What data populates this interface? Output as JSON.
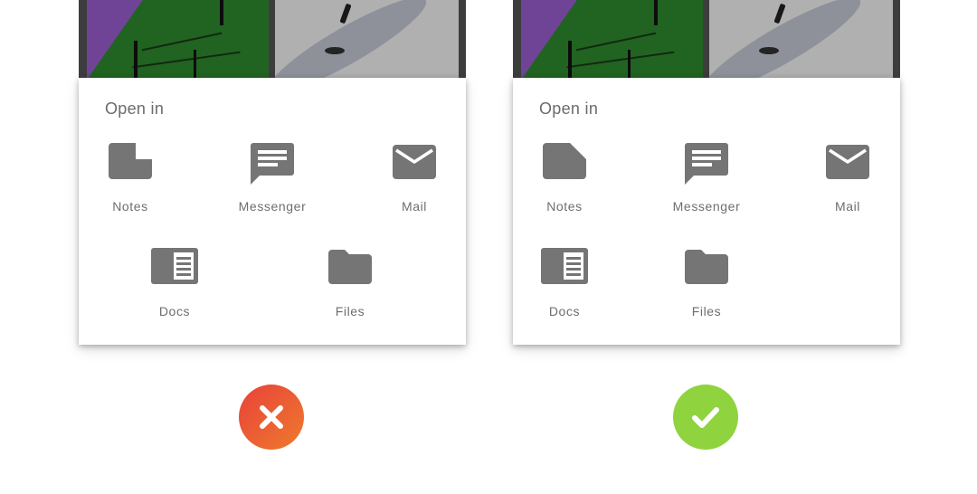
{
  "colors": {
    "icon_gray": "#757575",
    "text_gray": "#6e6e6e",
    "bad_badge": "#ea5a34",
    "good_badge": "#8fd33f"
  },
  "left": {
    "sheet_title": "Open in",
    "apps": [
      {
        "label": "Notes",
        "icon": "note-icon"
      },
      {
        "label": "Messenger",
        "icon": "message-icon"
      },
      {
        "label": "Mail",
        "icon": "mail-icon"
      },
      {
        "label": "Docs",
        "icon": "docs-icon"
      },
      {
        "label": "Files",
        "icon": "folder-icon"
      }
    ],
    "verdict": "incorrect",
    "verdict_icon": "x-icon"
  },
  "right": {
    "sheet_title": "Open in",
    "apps": [
      {
        "label": "Notes",
        "icon": "note-icon"
      },
      {
        "label": "Messenger",
        "icon": "message-icon"
      },
      {
        "label": "Mail",
        "icon": "mail-icon"
      },
      {
        "label": "Docs",
        "icon": "docs-icon"
      },
      {
        "label": "Files",
        "icon": "folder-icon"
      }
    ],
    "verdict": "correct",
    "verdict_icon": "check-icon"
  }
}
